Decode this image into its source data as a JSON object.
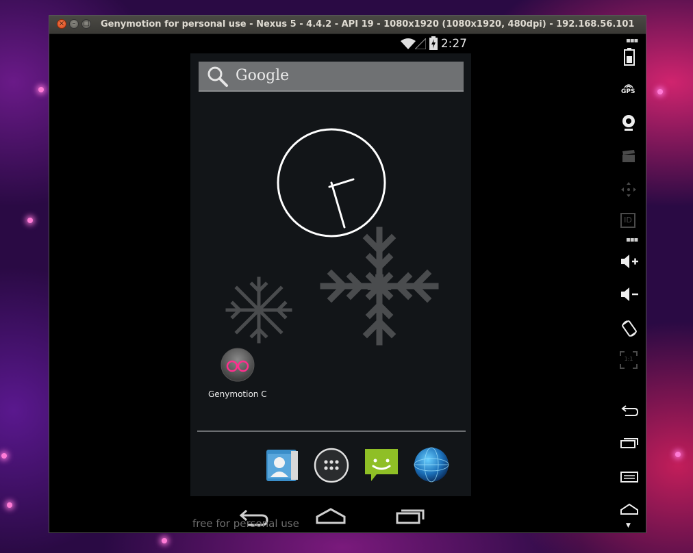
{
  "window": {
    "title": "Genymotion for personal use - Nexus 5 - 4.4.2 - API 19 - 1080x1920 (1080x1920, 480dpi) - 192.168.56.101"
  },
  "statusbar": {
    "time": "2:27"
  },
  "search": {
    "placeholder": "Google"
  },
  "desktop": {
    "app_label": "Genymotion C"
  },
  "footer": {
    "watermark": "free for personal use"
  },
  "sidebar": {
    "gps_label": "GPS",
    "id_label": "ID",
    "ratio_label": "1:1"
  },
  "colors": {
    "accent_pink": "#ff2f8e",
    "messaging_green": "#8fbf26"
  }
}
